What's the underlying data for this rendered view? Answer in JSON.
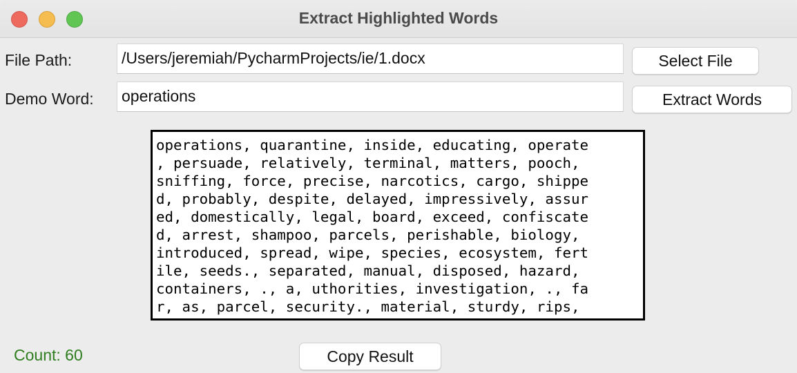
{
  "window": {
    "title": "Extract Highlighted Words"
  },
  "form": {
    "file_path_label": "File Path:",
    "file_path_value": "/Users/jeremiah/PycharmProjects/ie/1.docx",
    "demo_word_label": "Demo Word:",
    "demo_word_value": "operations",
    "select_file_label": "Select File",
    "extract_words_label": "Extract Words"
  },
  "result": {
    "lines": [
      "operations, quarantine, inside, educating, operate",
      ", persuade, relatively, terminal, matters, pooch,",
      "sniffing, force, precise, narcotics, cargo, shippe",
      "d, probably, despite, delayed, impressively, assur",
      "ed, domestically, legal, board, exceed, confiscate",
      "d, arrest, shampoo, parcels, perishable, biology,",
      "introduced, spread, wipe, species, ecosystem, fert",
      "ile, seeds., separated, manual, disposed, hazard,",
      "containers, ., a, uthorities, investigation, ., fa",
      "r, as, parcel, security., material, sturdy, rips,"
    ]
  },
  "footer": {
    "count_text": "Count: 60",
    "copy_result_label": "Copy Result"
  },
  "colors": {
    "count": "#2e7d1e",
    "close": "#ee6a5e",
    "minimize": "#f5bd4f",
    "maximize": "#61c554"
  }
}
